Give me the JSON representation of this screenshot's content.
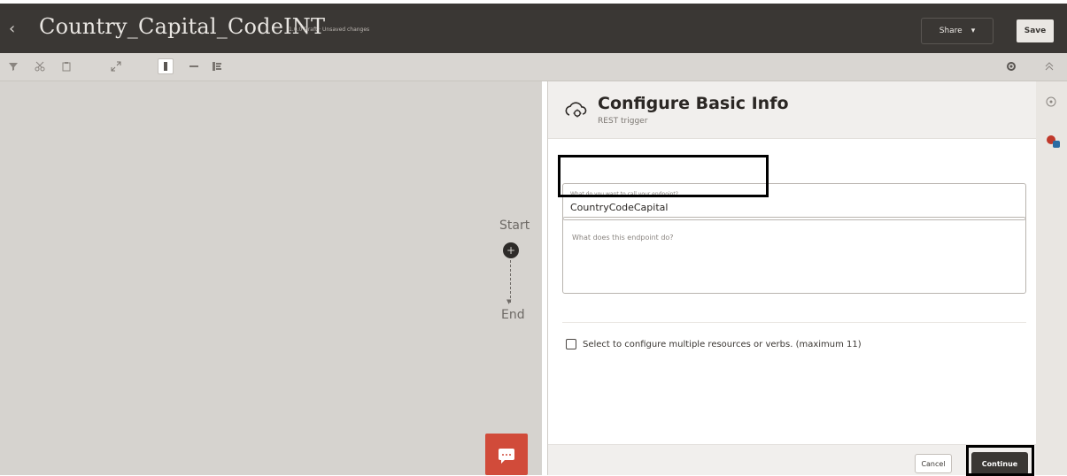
{
  "header": {
    "back_glyph": "‹",
    "title": "Country_Capital_CodeINT",
    "status": "1.0.0 Draft · Unsaved changes",
    "share_label": "Share",
    "share_caret": "▾",
    "save_label": "Save"
  },
  "toolbar": {
    "icons": [
      "filter-icon",
      "cut-icon",
      "paste-icon",
      "expand-icon",
      "vertical-layout-icon",
      "horizontal-layout-icon",
      "pseudo-layout-icon",
      "settings-icon",
      "chevron-up-icon"
    ]
  },
  "canvas": {
    "start_label": "Start",
    "end_label": "End",
    "add_glyph": "+",
    "arrow_glyph": "▼"
  },
  "panel": {
    "title": "Configure Basic Info",
    "subtitle": "REST trigger",
    "endpoint_name_label": "What do you want to call your endpoint?",
    "endpoint_name_value": "CountryCodeCapital",
    "endpoint_desc_placeholder": "What does this endpoint do?",
    "multi_resource_checkbox_label": "Select to configure multiple resources or verbs. (maximum 11)",
    "multi_resource_checked": false,
    "cancel_label": "Cancel",
    "continue_label": "Continue"
  },
  "rail": {
    "icons": [
      "help-icon",
      "palette-badge-icon"
    ]
  },
  "colors": {
    "header_bg": "#3a3734",
    "canvas_bg": "#d6d3cf",
    "chat_button": "#d14b3a",
    "primary_button": "#3a3734",
    "highlight_box": "#000000"
  }
}
